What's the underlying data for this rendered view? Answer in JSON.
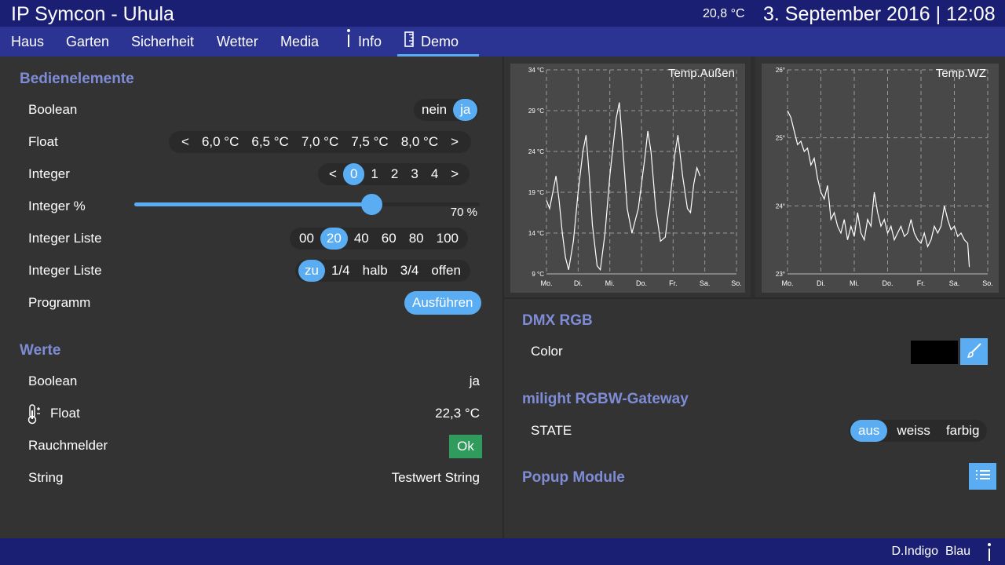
{
  "header": {
    "title": "IP Symcon - Uhula",
    "outside_temp": "20,8 °C",
    "datetime": "3. September 2016 | 12:08"
  },
  "nav": {
    "tabs": [
      {
        "label": "Haus",
        "icon": ""
      },
      {
        "label": "Garten",
        "icon": ""
      },
      {
        "label": "Sicherheit",
        "icon": ""
      },
      {
        "label": "Wetter",
        "icon": ""
      },
      {
        "label": "Media",
        "icon": ""
      },
      {
        "label": "Info",
        "icon": "info-icon"
      },
      {
        "label": "Demo",
        "icon": "ruler-icon"
      }
    ],
    "active": "Demo"
  },
  "bedienelemente": {
    "heading": "Bedienelemente",
    "boolean": {
      "label": "Boolean",
      "options": [
        "nein",
        "ja"
      ],
      "selected": "ja"
    },
    "float": {
      "label": "Float",
      "prev": "<",
      "next": ">",
      "options": [
        "6,0 °C",
        "6,5 °C",
        "7,0 °C",
        "7,5 °C",
        "8,0 °C"
      ]
    },
    "integer": {
      "label": "Integer",
      "prev": "<",
      "next": ">",
      "options": [
        "0",
        "1",
        "2",
        "3",
        "4"
      ],
      "selected": "0"
    },
    "integer_pct": {
      "label": "Integer %",
      "value": 70,
      "value_text": "70 %"
    },
    "integer_liste1": {
      "label": "Integer Liste",
      "options": [
        "00",
        "20",
        "40",
        "60",
        "80",
        "100"
      ],
      "selected": "20"
    },
    "integer_liste2": {
      "label": "Integer Liste",
      "options": [
        "zu",
        "1/4",
        "halb",
        "3/4",
        "offen"
      ],
      "selected": "zu"
    },
    "programm": {
      "label": "Programm",
      "button": "Ausführen"
    }
  },
  "werte": {
    "heading": "Werte",
    "boolean": {
      "label": "Boolean",
      "value": "ja"
    },
    "float": {
      "label": "Float",
      "value": "22,3 °C",
      "icon": "thermometer-icon"
    },
    "rauchmelder": {
      "label": "Rauchmelder",
      "value": "Ok"
    },
    "string": {
      "label": "String",
      "value": "Testwert String"
    }
  },
  "dmx": {
    "heading": "DMX RGB",
    "color_label": "Color",
    "color_value": "#000000",
    "button_icon": "brush-icon"
  },
  "milight": {
    "heading": "milight RGBW-Gateway",
    "state_label": "STATE",
    "options": [
      "aus",
      "weiss",
      "farbig"
    ],
    "selected": "aus"
  },
  "popup": {
    "heading": "Popup Module",
    "button_icon": "list-icon"
  },
  "footer": {
    "user": "D.Indigo",
    "theme": "Blau"
  },
  "colors": {
    "header_bg": "#1a1f74",
    "nav_bg": "#2b3393",
    "accent": "#5aadf2",
    "heading": "#7e8cd6",
    "ok": "#2f9b5d",
    "panel": "#333333",
    "chart_bg": "#484848"
  },
  "chart_data": [
    {
      "type": "line",
      "title": "Temp.Außen",
      "x_labels": [
        "Mo.",
        "Di.",
        "Mi.",
        "Do.",
        "Fr.",
        "Sa.",
        "So."
      ],
      "y_ticks": [
        "9 °C",
        "14 °C",
        "19 °C",
        "24 °C",
        "29 °C",
        "34 °C"
      ],
      "ylim": [
        9,
        34
      ],
      "xlim": [
        0,
        6
      ],
      "grid": true,
      "series": [
        {
          "points": [
            [
              0,
              18
            ],
            [
              0.1,
              17
            ],
            [
              0.2,
              19
            ],
            [
              0.3,
              21
            ],
            [
              0.4,
              18
            ],
            [
              0.5,
              14
            ],
            [
              0.6,
              11
            ],
            [
              0.7,
              9.5
            ],
            [
              0.85,
              13
            ],
            [
              1.0,
              19
            ],
            [
              1.15,
              24
            ],
            [
              1.25,
              26
            ],
            [
              1.35,
              21
            ],
            [
              1.45,
              15
            ],
            [
              1.6,
              10
            ],
            [
              1.7,
              9.5
            ],
            [
              1.85,
              14
            ],
            [
              2.0,
              21
            ],
            [
              2.2,
              28
            ],
            [
              2.3,
              30
            ],
            [
              2.4,
              25
            ],
            [
              2.55,
              17
            ],
            [
              2.7,
              14
            ],
            [
              2.9,
              17
            ],
            [
              3.1,
              23
            ],
            [
              3.2,
              26.5
            ],
            [
              3.3,
              24
            ],
            [
              3.45,
              17
            ],
            [
              3.6,
              13
            ],
            [
              3.75,
              13.5
            ],
            [
              3.9,
              18
            ],
            [
              4.05,
              23.5
            ],
            [
              4.15,
              26
            ],
            [
              4.3,
              21
            ],
            [
              4.45,
              17
            ],
            [
              4.55,
              16.5
            ],
            [
              4.65,
              20
            ],
            [
              4.75,
              22
            ],
            [
              4.85,
              21
            ]
          ]
        }
      ]
    },
    {
      "type": "line",
      "title": "Temp.WZ",
      "x_labels": [
        "Mo.",
        "Di.",
        "Mi.",
        "Do.",
        "Fr.",
        "Sa.",
        "So."
      ],
      "y_ticks": [
        "23°",
        "24°",
        "25°",
        "26°"
      ],
      "ylim": [
        23,
        26
      ],
      "xlim": [
        0,
        6
      ],
      "grid": true,
      "series": [
        {
          "points": [
            [
              0,
              25.4
            ],
            [
              0.1,
              25.3
            ],
            [
              0.2,
              25.1
            ],
            [
              0.3,
              24.9
            ],
            [
              0.4,
              24.95
            ],
            [
              0.5,
              24.8
            ],
            [
              0.6,
              24.85
            ],
            [
              0.7,
              24.6
            ],
            [
              0.8,
              24.7
            ],
            [
              0.9,
              24.4
            ],
            [
              1.0,
              24.2
            ],
            [
              1.1,
              24.1
            ],
            [
              1.2,
              24.3
            ],
            [
              1.3,
              23.8
            ],
            [
              1.4,
              23.9
            ],
            [
              1.5,
              23.7
            ],
            [
              1.6,
              23.6
            ],
            [
              1.7,
              23.8
            ],
            [
              1.8,
              23.5
            ],
            [
              1.9,
              23.7
            ],
            [
              2.0,
              23.55
            ],
            [
              2.1,
              23.9
            ],
            [
              2.2,
              23.6
            ],
            [
              2.3,
              23.5
            ],
            [
              2.4,
              23.8
            ],
            [
              2.5,
              23.7
            ],
            [
              2.6,
              24.2
            ],
            [
              2.7,
              23.9
            ],
            [
              2.8,
              23.7
            ],
            [
              2.9,
              23.8
            ],
            [
              3.0,
              23.6
            ],
            [
              3.1,
              23.7
            ],
            [
              3.2,
              23.5
            ],
            [
              3.3,
              23.6
            ],
            [
              3.4,
              23.7
            ],
            [
              3.5,
              23.55
            ],
            [
              3.6,
              23.6
            ],
            [
              3.7,
              23.8
            ],
            [
              3.8,
              23.6
            ],
            [
              3.9,
              23.5
            ],
            [
              4.0,
              23.45
            ],
            [
              4.1,
              23.6
            ],
            [
              4.2,
              23.4
            ],
            [
              4.3,
              23.5
            ],
            [
              4.4,
              23.7
            ],
            [
              4.5,
              23.6
            ],
            [
              4.6,
              23.7
            ],
            [
              4.7,
              24.0
            ],
            [
              4.8,
              23.8
            ],
            [
              4.9,
              23.65
            ],
            [
              5.0,
              23.7
            ],
            [
              5.1,
              23.55
            ],
            [
              5.2,
              23.6
            ],
            [
              5.3,
              23.5
            ],
            [
              5.4,
              23.45
            ],
            [
              5.45,
              23.1
            ]
          ]
        }
      ]
    }
  ]
}
